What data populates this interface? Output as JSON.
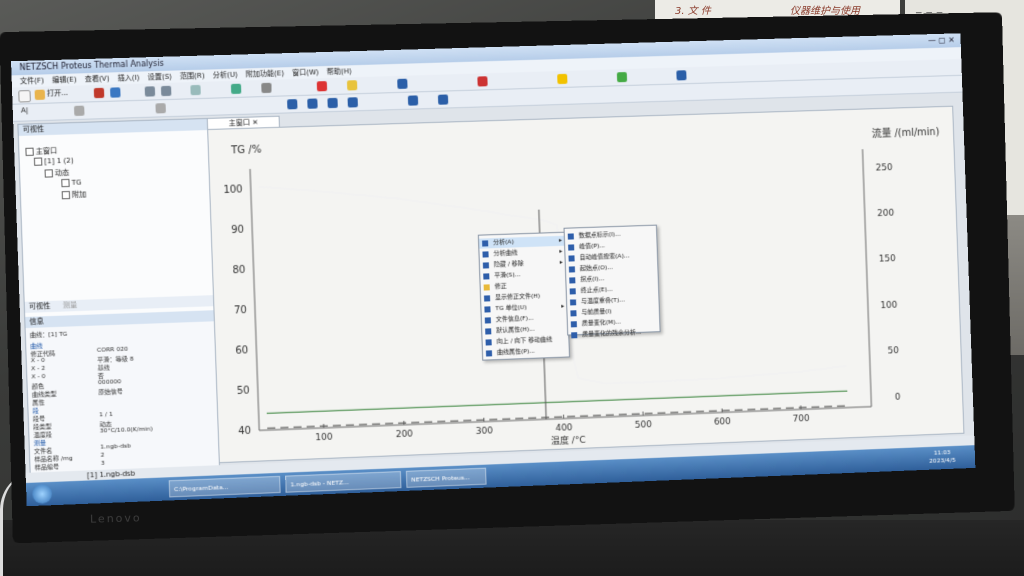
{
  "window": {
    "title": "NETZSCH Proteus Thermal Analysis"
  },
  "menubar": [
    "文件(F)",
    "编辑(E)",
    "查看(V)",
    "插入(I)",
    "设置(S)",
    "范围(R)",
    "分析(U)",
    "附加功能(E)",
    "窗口(W)",
    "帮助(H)"
  ],
  "toolbar": {
    "open_label": "打开..."
  },
  "left_panel": {
    "header": "可视性",
    "tree": [
      {
        "label": "主窗口"
      },
      {
        "label": "[1] 1 (2)"
      },
      {
        "label": "动态"
      },
      {
        "label": "TG"
      },
      {
        "label": "附加"
      }
    ],
    "tabs": [
      "可视性",
      "测量"
    ],
    "props_header": "信息",
    "props_sub": "曲线：[1] TG",
    "props": [
      {
        "k": "曲线",
        "v": "",
        "section": true
      },
      {
        "k": "修正代码",
        "v": "CORR 020"
      },
      {
        "k": "X - 0",
        "v": "平滑：等级 8"
      },
      {
        "k": "X - 2",
        "v": "基线"
      },
      {
        "k": "X - 0",
        "v": "否"
      },
      {
        "k": "颜色",
        "v": "000000"
      },
      {
        "k": "曲线类型",
        "v": "原始信号"
      },
      {
        "k": "属性",
        "v": ""
      },
      {
        "k": "段",
        "v": "",
        "section": true
      },
      {
        "k": "段号",
        "v": "1 / 1"
      },
      {
        "k": "段类型",
        "v": "动态"
      },
      {
        "k": "温度段",
        "v": "30°C/10.0(K/min)"
      },
      {
        "k": "测量",
        "v": "",
        "section": true
      },
      {
        "k": "文件名",
        "v": "1.ngb-dsb"
      },
      {
        "k": "样品名称 /mg",
        "v": "2"
      },
      {
        "k": "样品编号",
        "v": "3"
      }
    ]
  },
  "document": {
    "tab": "主窗口"
  },
  "chart_data": {
    "type": "line",
    "ylabel": "TG /%",
    "y2label": "流量 /(ml/min)",
    "xlabel": "温度 /°C",
    "yticks": [
      100,
      90,
      80,
      70,
      60,
      50,
      40
    ],
    "y2ticks": [
      250,
      200,
      150,
      100,
      50,
      0
    ],
    "xticks": [
      100,
      200,
      300,
      400,
      500,
      600,
      700
    ],
    "ylim": [
      40,
      105
    ],
    "y2lim": [
      -10,
      270
    ],
    "xlim": [
      20,
      790
    ],
    "series": [
      {
        "name": "TG",
        "color": "#f2f2f2",
        "x": [
          30,
          100,
          200,
          300,
          350,
          380,
          400,
          410,
          420,
          450,
          500,
          600,
          700,
          760
        ],
        "y": [
          100.5,
          99,
          96.5,
          93,
          91,
          90,
          88.5,
          60,
          50,
          48.5,
          48.3,
          48.6,
          49.5,
          50.5
        ]
      },
      {
        "name": "流量",
        "color": "#2e7d32",
        "x": [
          30,
          760
        ],
        "y2": [
          8,
          8
        ]
      },
      {
        "name": "dashed",
        "color": "#444444",
        "dashed": true,
        "x": [
          30,
          760
        ],
        "y2": [
          -8,
          -8
        ]
      }
    ],
    "cursor_x": 378,
    "grid": false
  },
  "context_menu": {
    "items": [
      {
        "label": "分析(A)",
        "selected": true,
        "submenu": true
      },
      {
        "label": "分析曲线",
        "submenu": true
      },
      {
        "label": "隐藏 / 移除",
        "submenu": true
      },
      {
        "label": "平滑(S)..."
      },
      {
        "label": "修正",
        "checked": true
      },
      {
        "label": "显示修正文件(H)"
      },
      {
        "label": "TG 单位(U)",
        "submenu": true
      },
      {
        "label": "文件信息(F)..."
      },
      {
        "label": "默认属性(H)..."
      },
      {
        "label": "向上 / 向下 移动曲线"
      },
      {
        "label": "曲线属性(P)..."
      }
    ]
  },
  "submenu": {
    "items": [
      {
        "label": "数据点标示(I)..."
      },
      {
        "label": "峰值(P)..."
      },
      {
        "label": "自动峰值搜索(A)..."
      },
      {
        "label": "起始点(O)..."
      },
      {
        "label": "拐点(I)..."
      },
      {
        "label": "终止点(E)..."
      },
      {
        "label": "与温度重叠(T)..."
      },
      {
        "label": "与前质量(I)"
      },
      {
        "label": "质量变化(M)..."
      },
      {
        "label": "质量变化的残余分析..."
      }
    ]
  },
  "statusbar": {
    "text": "[1] 1.ngb-dsb"
  },
  "taskbar": {
    "tasks": [
      "C:\\ProgramData...",
      "1.ngb-dsb - NETZ...",
      "NETZSCH Proteus..."
    ],
    "time": "11:03",
    "date": "2023/4/5"
  },
  "room": {
    "note1": "3. 文 件",
    "note2": "仪器维护与使用",
    "brand": "Lenovo"
  }
}
